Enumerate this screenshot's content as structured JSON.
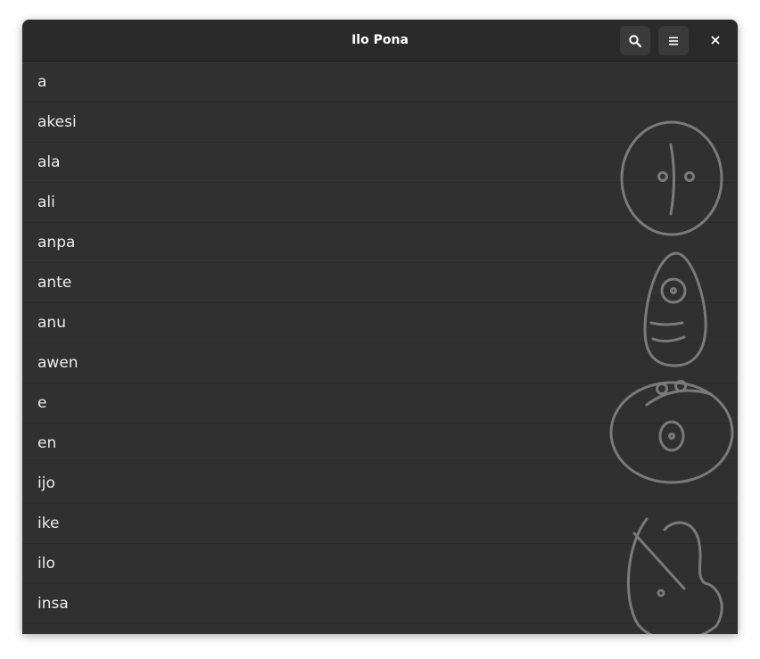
{
  "window": {
    "title": "Ilo Pona"
  },
  "header": {
    "search_icon": "search-icon",
    "menu_icon": "hamburger-menu-icon",
    "close_icon": "close-icon"
  },
  "words": [
    "a",
    "akesi",
    "ala",
    "ali",
    "anpa",
    "ante",
    "anu",
    "awen",
    "e",
    "en",
    "ijo",
    "ike",
    "ilo",
    "insa"
  ],
  "colors": {
    "window_bg": "#303030",
    "header_bg": "#2a2a2a",
    "text": "#ececec",
    "glyph_stroke": "#7a7a7a"
  }
}
